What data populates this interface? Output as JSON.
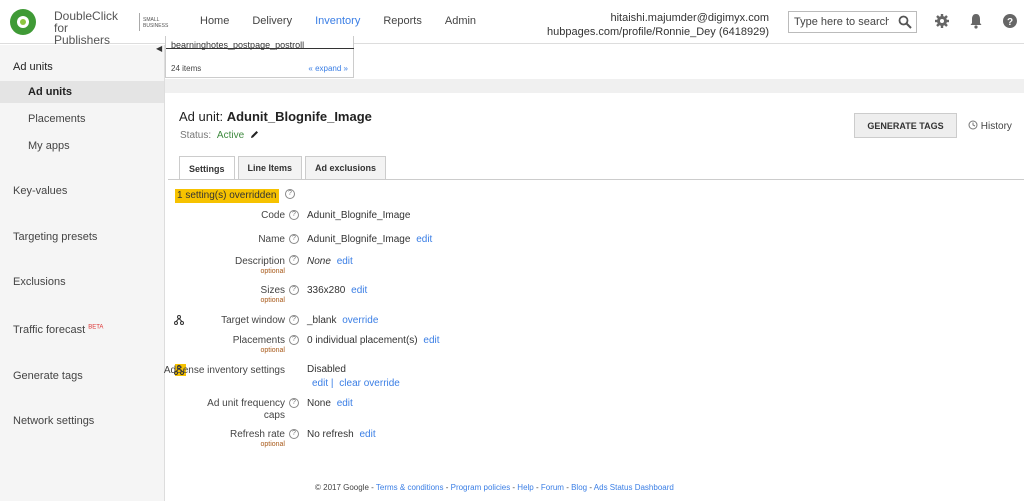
{
  "logo": {
    "line1": "DoubleClick",
    "line2": "for Publishers",
    "sub": "SMALL BUSINESS"
  },
  "nav": [
    {
      "label": "Home"
    },
    {
      "label": "Delivery"
    },
    {
      "label": "Inventory"
    },
    {
      "label": "Reports"
    },
    {
      "label": "Admin"
    }
  ],
  "account": {
    "email": "hitaishi.majumder@digimyx.com",
    "network": "hubpages.com/profile/Ronnie_Dey (6418929)"
  },
  "search": {
    "placeholder": "Type here to search..."
  },
  "sidebar": {
    "items": [
      {
        "label": "Ad units"
      },
      {
        "label": "Ad units"
      },
      {
        "label": "Placements"
      },
      {
        "label": "My apps"
      },
      {
        "label": "Key-values"
      },
      {
        "label": "Targeting presets"
      },
      {
        "label": "Exclusions"
      },
      {
        "label": "Traffic forecast",
        "badge": "BETA"
      },
      {
        "label": "Generate tags"
      },
      {
        "label": "Network settings"
      }
    ]
  },
  "list": {
    "selected": "bearninghotes_postpage_postroll",
    "count": "24 items",
    "expand": "« expand »"
  },
  "adunit": {
    "title_prefix": "Ad unit:",
    "title_name": "Adunit_Blognife_Image",
    "status_label": "Status:",
    "status_value": "Active",
    "generate_label": "GENERATE TAGS",
    "history_label": "History"
  },
  "tabs": [
    {
      "label": "Settings"
    },
    {
      "label": "Line Items"
    },
    {
      "label": "Ad exclusions"
    }
  ],
  "settings": {
    "override_badge": "1 setting(s) overridden",
    "code": {
      "label": "Code",
      "value": "Adunit_Blognife_Image"
    },
    "name": {
      "label": "Name",
      "value": "Adunit_Blognife_Image",
      "action": "edit"
    },
    "description": {
      "label": "Description",
      "optional": "optional",
      "value": "None",
      "action": "edit"
    },
    "sizes": {
      "label": "Sizes",
      "optional": "optional",
      "value": "336x280",
      "action": "edit"
    },
    "target_window": {
      "label": "Target window",
      "value": "_blank",
      "action": "override"
    },
    "placements": {
      "label": "Placements",
      "optional": "optional",
      "value": "0 individual placement(s)",
      "action": "edit"
    },
    "adsense": {
      "label": "AdSense inventory settings",
      "value": "Disabled",
      "action1": "edit |",
      "action2": "clear override"
    },
    "freq_caps": {
      "label1": "Ad unit frequency",
      "label2": "caps",
      "value": "None",
      "action": "edit"
    },
    "refresh": {
      "label": "Refresh rate",
      "optional": "optional",
      "value": "No refresh",
      "action": "edit"
    }
  },
  "footer": {
    "copyright": "© 2017 Google -",
    "links": [
      "Terms & conditions",
      "Program policies",
      "Help",
      "Forum",
      "Blog",
      "Ads Status Dashboard"
    ]
  },
  "colors": {
    "accent": "#3a7ee5",
    "active_status": "#3f8a3f",
    "override": "#f6c200",
    "optional": "#a85a1a"
  }
}
